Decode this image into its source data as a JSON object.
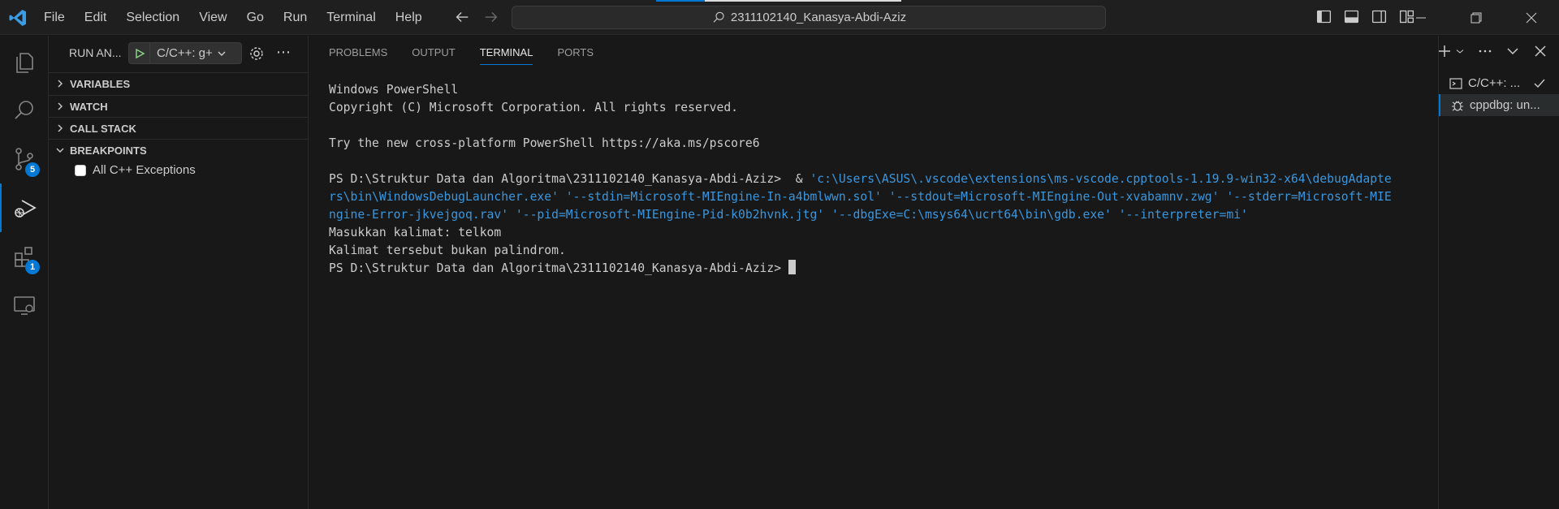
{
  "menu": [
    "File",
    "Edit",
    "Selection",
    "View",
    "Go",
    "Run",
    "Terminal",
    "Help"
  ],
  "search": {
    "text": "2311102140_Kanasya-Abdi-Aziz"
  },
  "activity": {
    "source_control_badge": "5",
    "extensions_badge": "1"
  },
  "sidebar": {
    "title": "RUN AN...",
    "run_config": "C/C++: g+",
    "sections": {
      "variables": "VARIABLES",
      "watch": "WATCH",
      "call_stack": "CALL STACK",
      "breakpoints": "BREAKPOINTS"
    },
    "breakpoint_item": "All C++ Exceptions"
  },
  "panel": {
    "tabs": [
      "PROBLEMS",
      "OUTPUT",
      "TERMINAL",
      "PORTS"
    ],
    "active_tab": "TERMINAL"
  },
  "terminal": {
    "line1": "Windows PowerShell",
    "line2": "Copyright (C) Microsoft Corporation. All rights reserved.",
    "line3": "",
    "line4": "Try the new cross-platform PowerShell https://aka.ms/pscore6",
    "line5": "",
    "prompt_path": "PS D:\\Struktur Data dan Algoritma\\2311102140_Kanasya-Abdi-Aziz>  & ",
    "cmd_line1": "'c:\\Users\\ASUS\\.vscode\\extensions\\ms-vscode.cpptools-1.19.9-win32-x64\\debugAdapte",
    "cmd_line2": "rs\\bin\\WindowsDebugLauncher.exe' '--stdin=Microsoft-MIEngine-In-a4bmlwwn.sol' '--stdout=Microsoft-MIEngine-Out-xvabamnv.zwg' '--stderr=Microsoft-MIE",
    "cmd_line3": "ngine-Error-jkvejgoq.rav' '--pid=Microsoft-MIEngine-Pid-k0b2hvnk.jtg' '--dbgExe=C:\\msys64\\ucrt64\\bin\\gdb.exe' '--interpreter=mi'",
    "line6": "Masukkan kalimat: telkom",
    "line7": "Kalimat tersebut bukan palindrom.",
    "line8": "PS D:\\Struktur Data dan Algoritma\\2311102140_Kanasya-Abdi-Aziz> "
  },
  "terminal_list": [
    {
      "label": "C/C++: ...",
      "icon": "terminal-icon"
    },
    {
      "label": "cppdbg: un...",
      "icon": "debug-icon"
    }
  ],
  "colors": {
    "accent": "#0078d4",
    "command": "#3a96dd"
  }
}
